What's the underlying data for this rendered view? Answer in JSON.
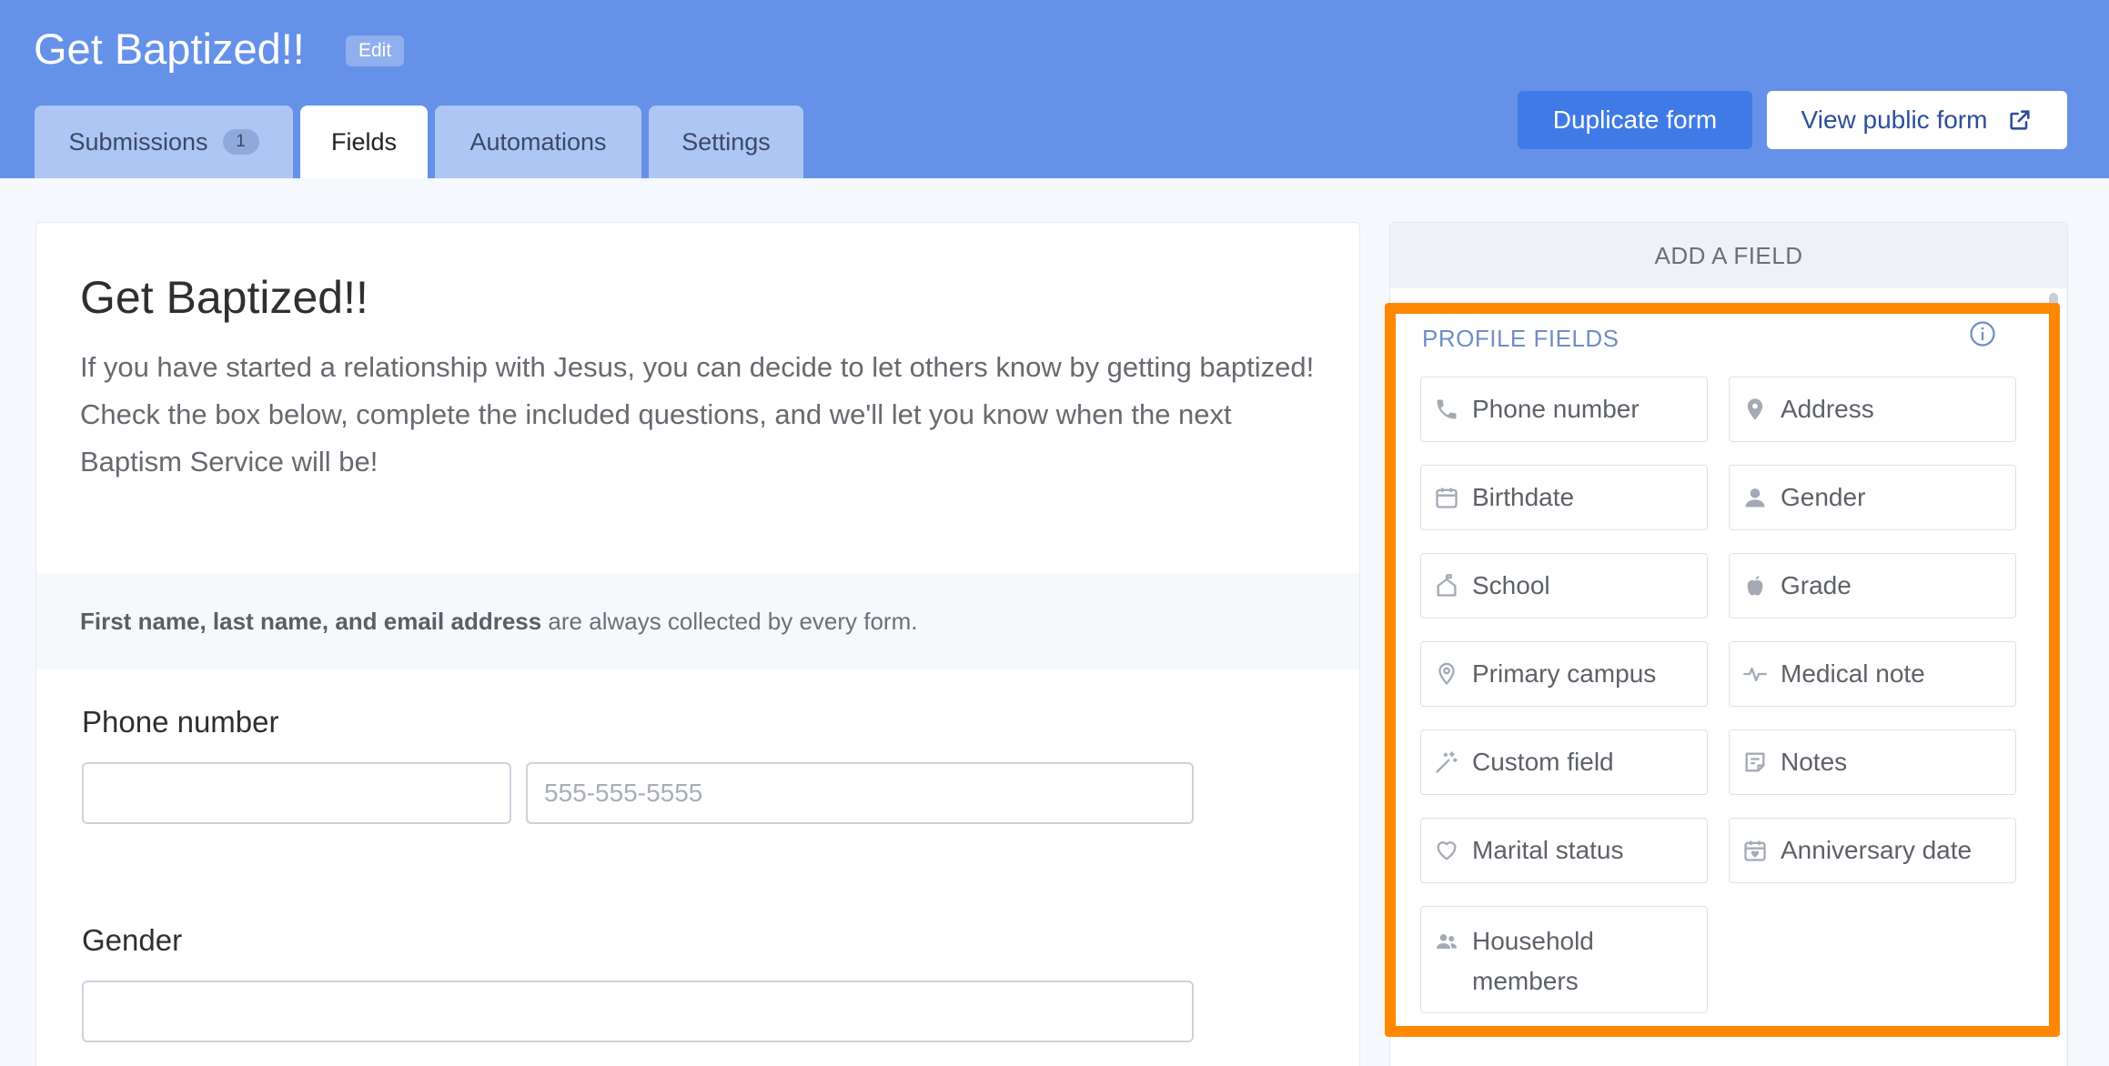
{
  "header": {
    "title": "Get Baptized!!",
    "edit_label": "Edit",
    "tabs": [
      {
        "label": "Submissions",
        "count": "1"
      },
      {
        "label": "Fields"
      },
      {
        "label": "Automations"
      },
      {
        "label": "Settings"
      }
    ],
    "active_tab": "Fields",
    "duplicate_label": "Duplicate form",
    "view_public_label": "View public form"
  },
  "form": {
    "title": "Get Baptized!!",
    "description": "If you have started a relationship with Jesus, you can decide to let others know by getting baptized! Check the box below, complete the included questions, and we'll let you know when the next Baptism Service will be!",
    "notice_bold": "First name, last name, and email address",
    "notice_rest": " are always collected by every form.",
    "fields": [
      {
        "label": "Phone number",
        "inputs": [
          {
            "value": "",
            "placeholder": ""
          },
          {
            "value": "",
            "placeholder": "555-555-5555"
          }
        ]
      },
      {
        "label": "Gender",
        "inputs": [
          {
            "value": "",
            "placeholder": ""
          }
        ]
      }
    ]
  },
  "panel": {
    "heading": "ADD A FIELD",
    "section_label": "PROFILE FIELDS",
    "items": [
      {
        "label": "Phone number",
        "icon": "phone-icon"
      },
      {
        "label": "Address",
        "icon": "map-pin-icon"
      },
      {
        "label": "Birthdate",
        "icon": "calendar-icon"
      },
      {
        "label": "Gender",
        "icon": "person-icon"
      },
      {
        "label": "School",
        "icon": "school-icon"
      },
      {
        "label": "Grade",
        "icon": "apple-icon"
      },
      {
        "label": "Primary campus",
        "icon": "location-outline-icon"
      },
      {
        "label": "Medical note",
        "icon": "pulse-icon"
      },
      {
        "label": "Custom field",
        "icon": "magic-wand-icon"
      },
      {
        "label": "Notes",
        "icon": "note-icon"
      },
      {
        "label": "Marital status",
        "icon": "heart-icon"
      },
      {
        "label": "Anniversary date",
        "icon": "calendar-heart-icon"
      },
      {
        "label": "Household\nmembers",
        "icon": "people-icon"
      }
    ]
  },
  "colors": {
    "header_bg": "#6591e8",
    "primary_button": "#3f7ae6",
    "highlight": "#ff8800",
    "section_label": "#6f8ec5",
    "icon": "#a3aab5"
  }
}
